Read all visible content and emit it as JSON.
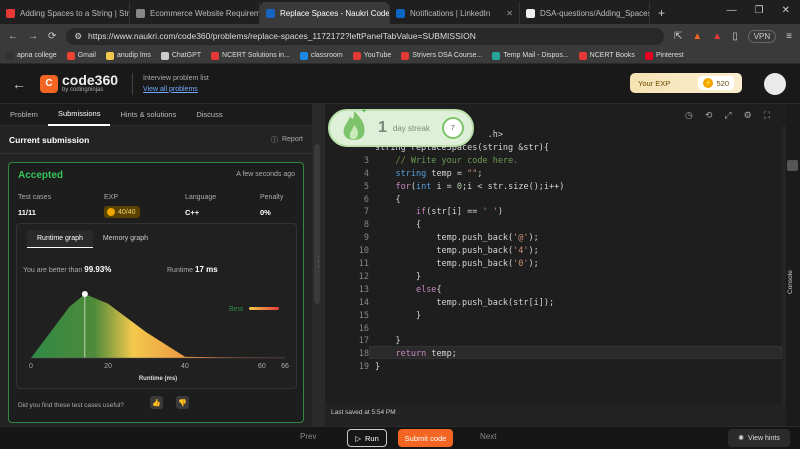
{
  "browser": {
    "tabs": [
      {
        "title": "Adding Spaces to a String | Stri…",
        "fav": "#e53935",
        "active": false
      },
      {
        "title": "Ecommerce Website Requireme…",
        "fav": "#888888",
        "active": false
      },
      {
        "title": "Replace Spaces - Naukri Code…",
        "fav": "#1565c0",
        "active": true
      },
      {
        "title": "Notifications | LinkedIn",
        "fav": "#0a66c2",
        "active": false
      },
      {
        "title": "DSA-questions/Adding_Spaces…",
        "fav": "#eeeeee",
        "active": false
      }
    ],
    "url": "https://www.naukri.com/code360/problems/replace-spaces_1172172?leftPanelTabValue=SUBMISSION",
    "vpn": "VPN",
    "bookmarks": [
      {
        "label": "apna college",
        "color": "#333333"
      },
      {
        "label": "Gmail",
        "color": "#ea4335"
      },
      {
        "label": "anudip lms",
        "color": "#f2c94c"
      },
      {
        "label": "ChatGPT",
        "color": "#cccccc"
      },
      {
        "label": "NCERT Solutions in...",
        "color": "#e53935"
      },
      {
        "label": "classroom",
        "color": "#1e88e5"
      },
      {
        "label": "YouTube",
        "color": "#e53935"
      },
      {
        "label": "Strivers DSA Course...",
        "color": "#e53935"
      },
      {
        "label": "Temp Mail - Dispos...",
        "color": "#26a69a"
      },
      {
        "label": "NCERT Books",
        "color": "#e53935"
      },
      {
        "label": "Pinterest",
        "color": "#e60023"
      }
    ]
  },
  "header": {
    "logo_main": "code360",
    "logo_sub": "by codingninjas",
    "list_label": "Interview problem list",
    "list_link": "View all problems",
    "exp_label": "Your EXP",
    "exp_value": "520"
  },
  "left_tabs": [
    "Problem",
    "Submissions",
    "Hints & solutions",
    "Discuss"
  ],
  "submission": {
    "title": "Current submission",
    "report": "Report",
    "status": "Accepted",
    "time_ago": "A few seconds ago",
    "stats": [
      {
        "label": "Test cases",
        "value": "11/11"
      },
      {
        "label": "EXP",
        "value": "40/40"
      },
      {
        "label": "Language",
        "value": "C++"
      },
      {
        "label": "Penalty",
        "value": "0%"
      }
    ],
    "graph_tabs": [
      "Runtime graph",
      "Memory graph"
    ],
    "better_label": "You are better than",
    "better_value": "99.93%",
    "runtime_label": "Runtime",
    "runtime_value": "17 ms",
    "feedback": "Did you find these test cases useful?"
  },
  "chart_data": {
    "type": "area",
    "x": [
      0,
      5,
      10,
      14,
      20,
      30,
      40,
      50,
      60,
      66
    ],
    "y": [
      0,
      40,
      80,
      100,
      85,
      40,
      2,
      1,
      0.5,
      0.3
    ],
    "xticks": [
      0,
      20,
      40,
      60,
      66
    ],
    "xlabel": "Runtime (ms)",
    "marker_x": 14,
    "legend": "Best",
    "colors": {
      "good": "#2f8a45",
      "mid": "#f2c94c",
      "bad": "#e53935"
    }
  },
  "editor": {
    "lines": [
      {
        "n": "",
        "html": "                      .h>"
      },
      {
        "n": "",
        "html": "string replaceSpaces(string &str){"
      },
      {
        "n": "3",
        "html": "    <span class='cm'>// Write your code here.</span>"
      },
      {
        "n": "4",
        "html": "    <span class='ty'>string</span> temp = <span class='st'>\"\"</span>;"
      },
      {
        "n": "5",
        "html": "    <span class='kw'>for</span>(<span class='ty'>int</span> i = <span class='nm'>0</span>;i &lt; str.size();i++)"
      },
      {
        "n": "6",
        "html": "    {"
      },
      {
        "n": "7",
        "html": "        <span class='kw'>if</span>(str[i] == <span class='st'>' '</span>)"
      },
      {
        "n": "8",
        "html": "        {"
      },
      {
        "n": "9",
        "html": "            temp.push_back(<span class='st'>'@'</span>);"
      },
      {
        "n": "10",
        "html": "            temp.push_back(<span class='st'>'4'</span>);"
      },
      {
        "n": "11",
        "html": "            temp.push_back(<span class='st'>'0'</span>);"
      },
      {
        "n": "12",
        "html": "        }"
      },
      {
        "n": "13",
        "html": "        <span class='kw'>else</span>{"
      },
      {
        "n": "14",
        "html": "            temp.push_back(str[i]);"
      },
      {
        "n": "15",
        "html": "        }"
      },
      {
        "n": "16",
        "html": ""
      },
      {
        "n": "17",
        "html": "    }"
      },
      {
        "n": "18",
        "html": "    <span class='kw'>return</span> temp;"
      },
      {
        "n": "19",
        "html": "}"
      }
    ],
    "saved": "Last saved at 5:54 PM",
    "console": "Console"
  },
  "bottom": {
    "prev": "Prev",
    "run": "Run",
    "submit": "Submit code",
    "next": "Next",
    "hints": "View hints"
  },
  "streak": {
    "num": "1",
    "text": "day streak",
    "badge": "7"
  }
}
